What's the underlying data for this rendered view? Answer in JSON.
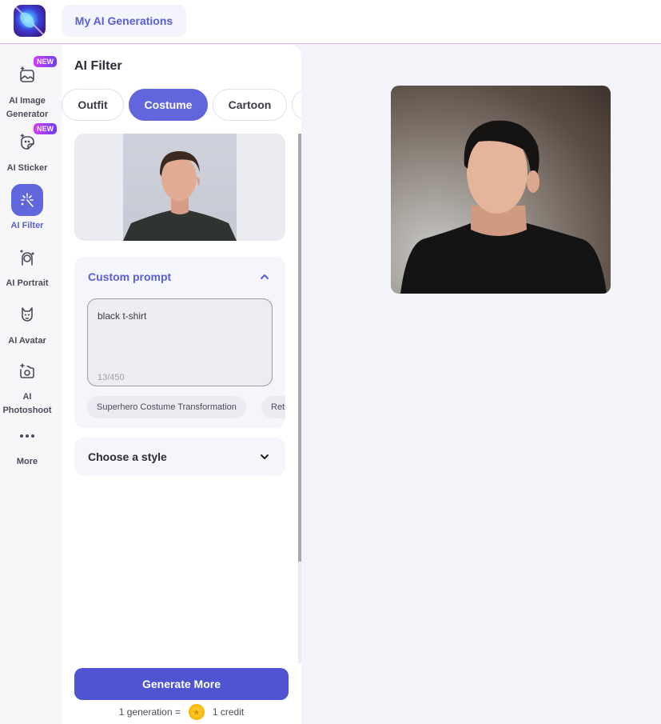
{
  "header": {
    "logo_alt": "app-logo",
    "my_generations_label": "My AI Generations"
  },
  "sidebar": {
    "items": [
      {
        "label": "AI Image Generator",
        "icon": "image-sparkle-icon",
        "badge": "NEW",
        "active": false
      },
      {
        "label": "AI Sticker",
        "icon": "sticker-icon",
        "badge": "NEW",
        "active": false
      },
      {
        "label": "AI Filter",
        "icon": "magic-wand-icon",
        "badge": null,
        "active": true
      },
      {
        "label": "AI Portrait",
        "icon": "portrait-icon",
        "badge": null,
        "active": false
      },
      {
        "label": "AI Avatar",
        "icon": "avatar-mask-icon",
        "badge": null,
        "active": false
      },
      {
        "label": "AI Photoshoot",
        "icon": "camera-sparkle-icon",
        "badge": null,
        "active": false
      },
      {
        "label": "More",
        "icon": "more-dots-icon",
        "badge": null,
        "active": false
      }
    ]
  },
  "panel": {
    "title": "AI Filter",
    "tabs": [
      {
        "label": "Outfit",
        "active": false
      },
      {
        "label": "Costume",
        "active": true
      },
      {
        "label": "Cartoon",
        "active": false
      }
    ],
    "custom_prompt": {
      "title": "Custom prompt",
      "value": "black t-shirt",
      "counter": "13/450",
      "suggestions": [
        "Superhero Costume Transformation",
        "Retro"
      ]
    },
    "style": {
      "title": "Choose a style"
    },
    "generate_label": "Generate More",
    "credit": {
      "left": "1 generation =",
      "right": "1 credit"
    }
  },
  "colors": {
    "accent": "#6166dc",
    "button": "#4f54d0",
    "badge_from": "#d13ef2",
    "badge_to": "#6a3ff0"
  }
}
